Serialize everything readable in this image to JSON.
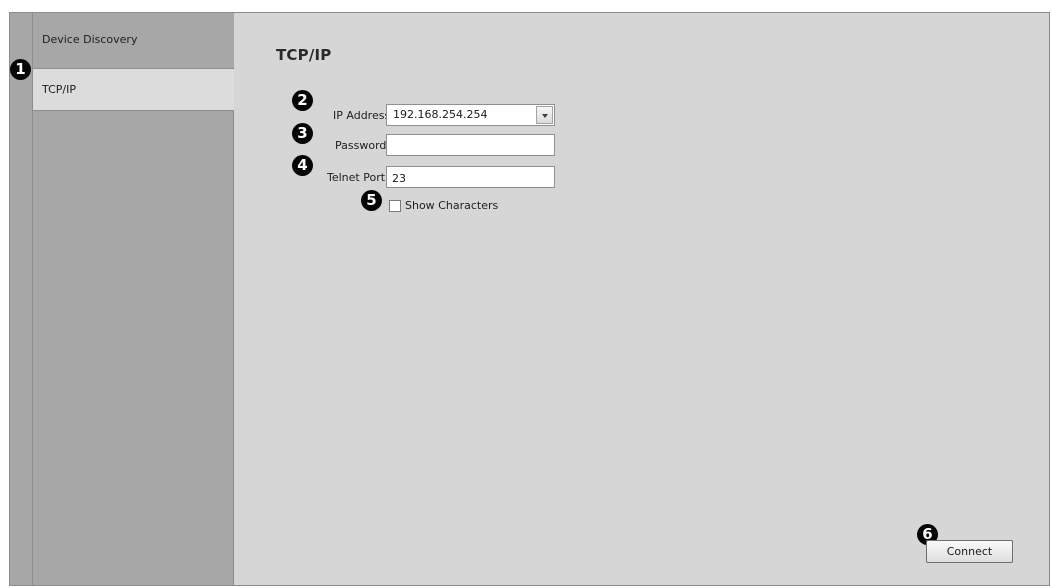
{
  "sidebar": {
    "items": [
      {
        "label": "Device Discovery",
        "selected": false
      },
      {
        "label": "TCP/IP",
        "selected": true
      }
    ]
  },
  "main": {
    "title": "TCP/IP",
    "ip_address": {
      "label": "IP Address:",
      "value": "192.168.254.254"
    },
    "password": {
      "label": "Password:",
      "value": ""
    },
    "telnet_port": {
      "label": "Telnet Port:",
      "value": "23"
    },
    "show_characters": {
      "label": "Show Characters",
      "checked": false
    }
  },
  "footer": {
    "connect_label": "Connect"
  },
  "callouts": [
    "1",
    "2",
    "3",
    "4",
    "5",
    "6"
  ],
  "colors": {
    "sidebar_bg": "#a7a7a7",
    "selected_item_bg": "#dcdcdc",
    "panel_bg": "#d6d6d6",
    "callout_bg": "#050505"
  }
}
